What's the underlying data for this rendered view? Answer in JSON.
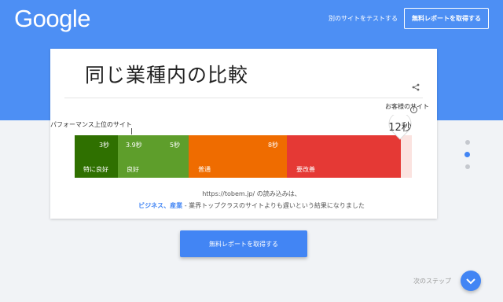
{
  "header": {
    "logo_text": "Google",
    "test_other_site_label": "別のサイトをテストする",
    "free_report_label": "無料レポートを取得する"
  },
  "card": {
    "title": "同じ業種内の比較",
    "share_icon": "share-icon",
    "top_sites_label": "パフォーマンス上位のサイト",
    "customer_site_label": "お客様のサイト",
    "customer_time": "12秒",
    "segments": [
      {
        "value": "3秒",
        "label": "特に良好",
        "color": "#2f7000"
      },
      {
        "value": "5秒",
        "value_left": "3.9秒",
        "label": "良好",
        "color": "#5e9e2b"
      },
      {
        "value": "8秒",
        "label": "普通",
        "color": "#ef6c00"
      },
      {
        "value": "",
        "label": "要改善",
        "color": "#e53935"
      }
    ],
    "site_line": "https://tobem.jp/ の読み込みは、",
    "categories_text": "ビジネス、産業",
    "result_text": " - 業界トップクラスのサイトよりも遅いという結果になりました"
  },
  "cta": {
    "report_label": "無料レポートを取得する"
  },
  "pager": {
    "next_step_label": "次のステップ",
    "active_index": 1
  }
}
